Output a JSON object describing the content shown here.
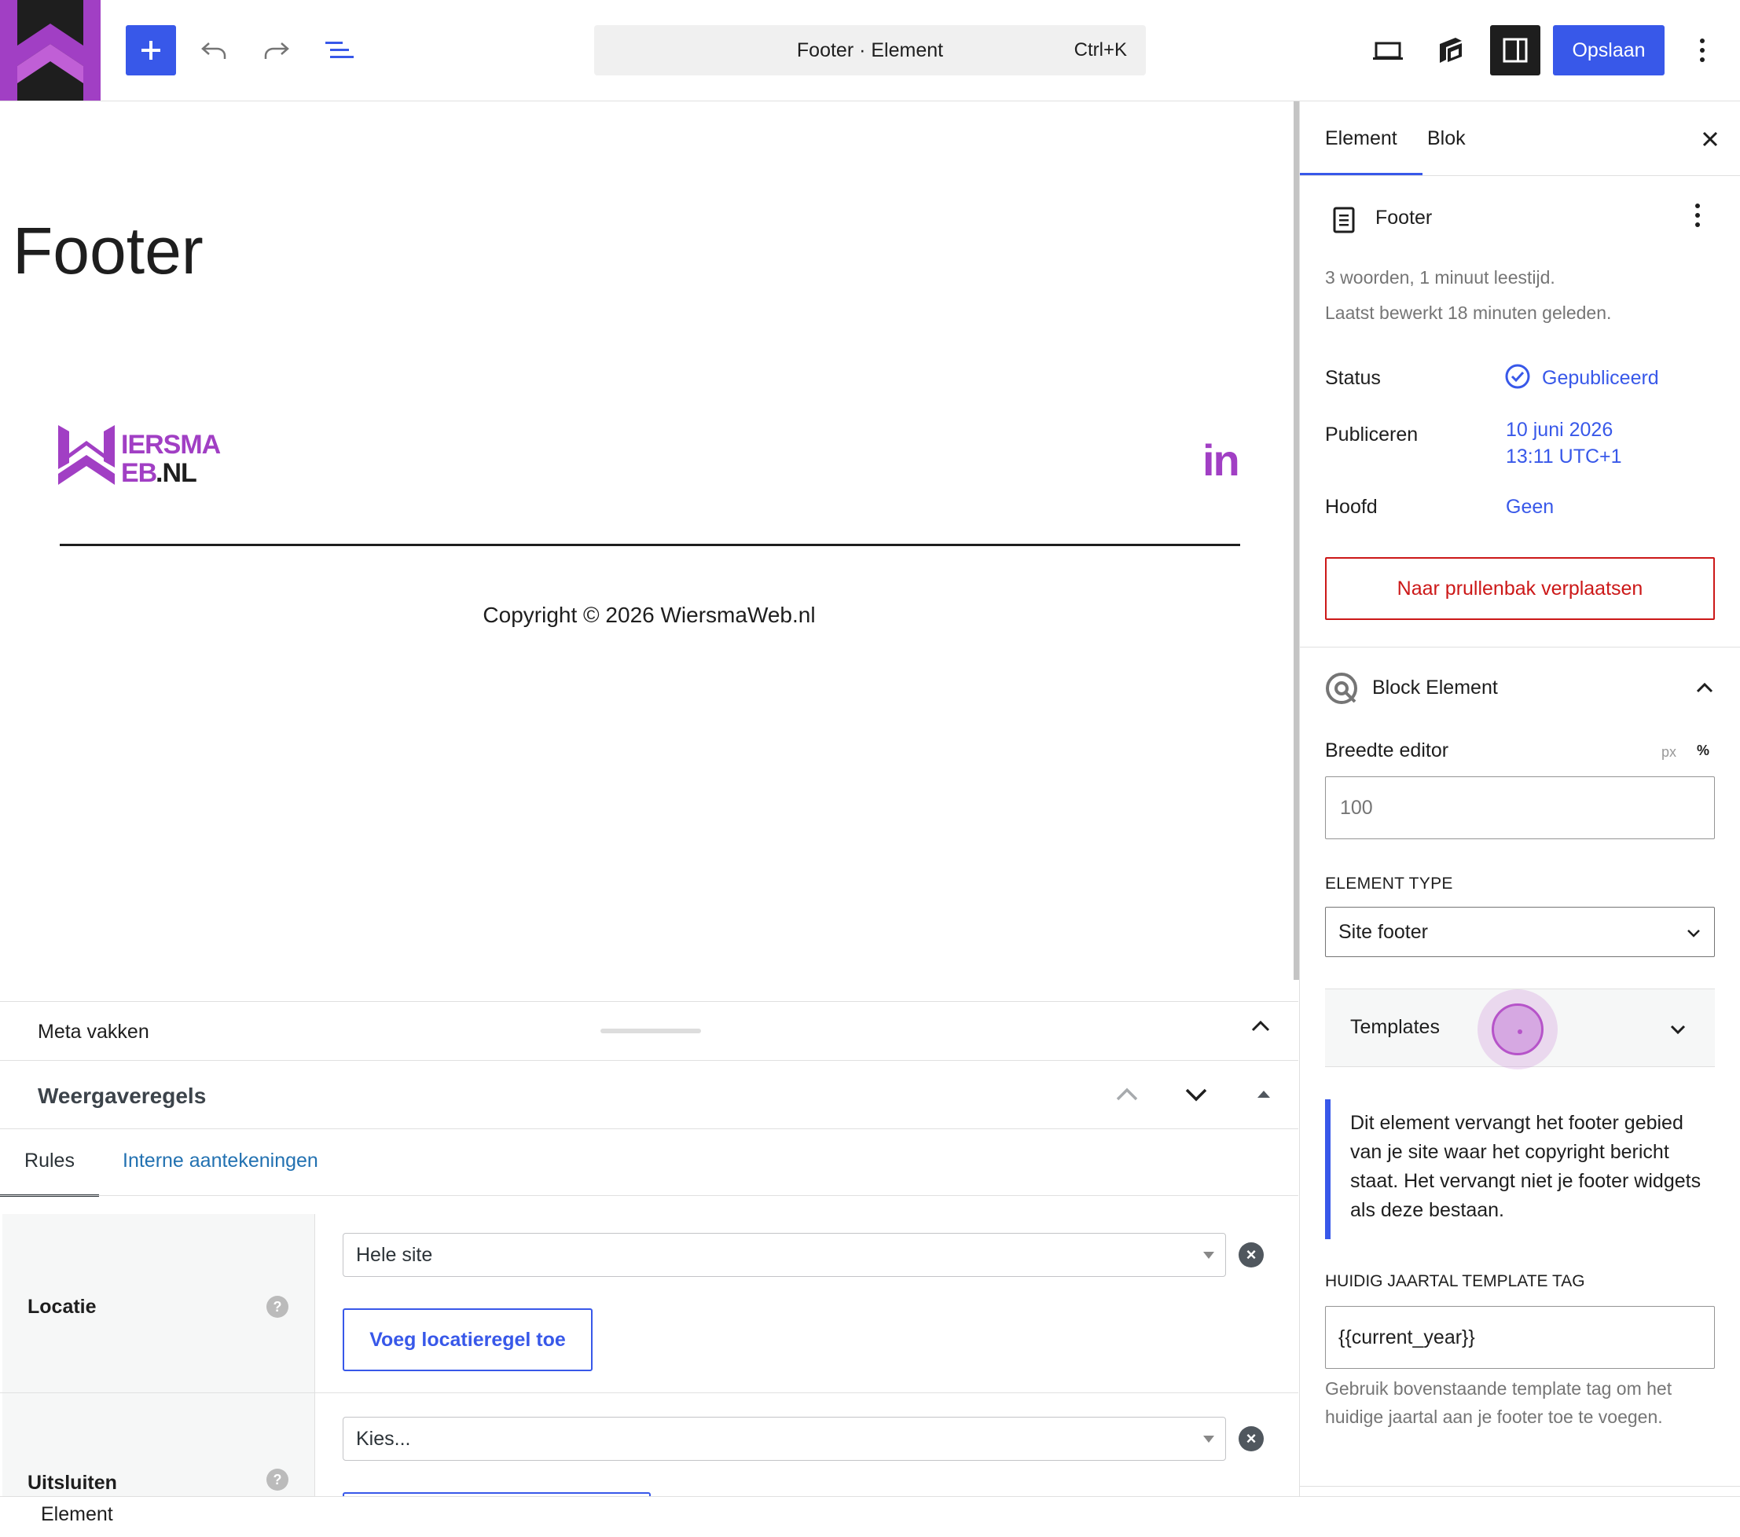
{
  "topbar": {
    "command_title": "Footer · Element",
    "command_shortcut": "Ctrl+K",
    "save_label": "Opslaan"
  },
  "canvas": {
    "page_title": "Footer",
    "logo_text_line1": "IERSMA",
    "logo_text_line2_colored": "EB",
    "logo_text_line2_dark": ".NL",
    "social_icon_text": "in",
    "copyright": "Copyright © 2026 WiersmaWeb.nl"
  },
  "meta": {
    "title": "Meta vakken",
    "rules_title": "Weergaveregels",
    "tabs": [
      {
        "label": "Rules"
      },
      {
        "label": "Interne aantekeningen"
      }
    ],
    "location": {
      "label": "Locatie",
      "help": "?",
      "select_value": "Hele site",
      "add_button": "Voeg locatieregel toe"
    },
    "exclude": {
      "label": "Uitsluiten",
      "help": "?",
      "select_value": "Kies..."
    }
  },
  "status_footer": {
    "breadcrumb": "Element"
  },
  "sidebar": {
    "tabs": [
      {
        "label": "Element"
      },
      {
        "label": "Blok"
      }
    ],
    "document": {
      "title": "Footer",
      "meta_words": "3 woorden, 1 minuut leestijd.",
      "meta_edited": "Laatst bewerkt 18 minuten geleden."
    },
    "props": {
      "status_label": "Status",
      "status_value": "Gepubliceerd",
      "publish_label": "Publiceren",
      "publish_date": "10 juni 2026",
      "publish_time": "13:11 UTC+1",
      "parent_label": "Hoofd",
      "parent_value": "Geen"
    },
    "trash_label": "Naar prullenbak verplaatsen",
    "block_element": {
      "title": "Block Element",
      "width_label": "Breedte editor",
      "unit_px": "px",
      "unit_pct": "%",
      "width_placeholder": "100",
      "element_type_label": "ELEMENT TYPE",
      "element_type_value": "Site footer",
      "templates_label": "Templates",
      "notice": "Dit element vervangt het footer gebied van je site waar het copyright bericht staat. Het vervangt niet je footer widgets als deze bestaan.",
      "year_tag_label": "HUIDIG JAARTAL TEMPLATE TAG",
      "year_tag_value": "{{current_year}}",
      "year_tag_help": "Gebruik bovenstaande template tag om het huidige jaartal aan je footer toe te voegen."
    }
  },
  "colors": {
    "accent": "#3858e9",
    "brand_purple": "#a13fc4",
    "danger": "#cc1818"
  }
}
